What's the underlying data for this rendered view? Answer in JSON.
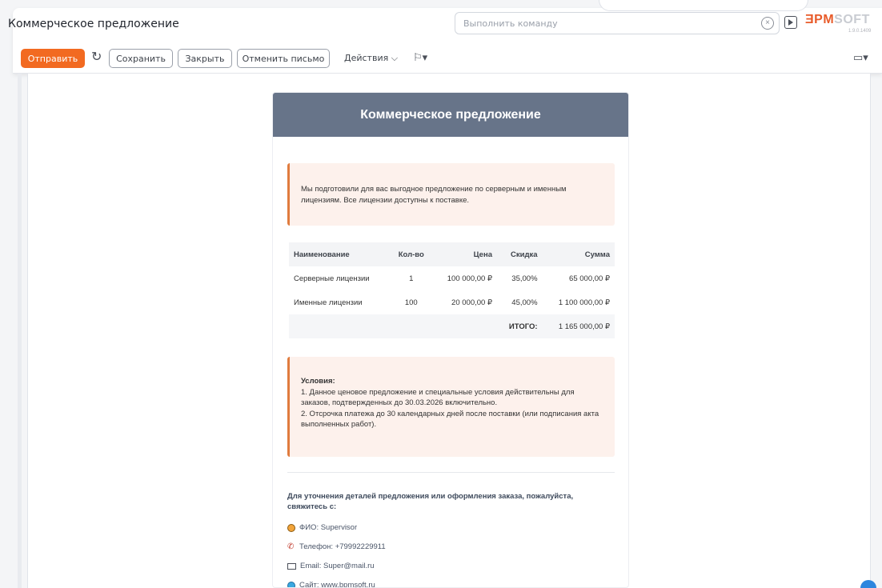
{
  "header": {
    "title": "Коммерческое предложение",
    "command_placeholder": "Выполнить команду",
    "logo_part_a": "ƎPM",
    "logo_part_b": "SOFT",
    "logo_version": "1.9.0.1409"
  },
  "toolbar": {
    "send_label": "Отправить",
    "save_label": "Сохранить",
    "close_label": "Закрыть",
    "cancel_email_label": "Отменить письмо",
    "actions_label": "Действия"
  },
  "email": {
    "heading": "Коммерческое предложение",
    "intro": "Мы подготовили для вас выгодное предложение по серверным и именным лицензиям. Все лицензии доступны к поставке.",
    "table": {
      "headers": [
        "Наименование",
        "Кол-во",
        "Цена",
        "Скидка",
        "Сумма"
      ],
      "rows": [
        [
          "Серверные лицензии",
          "1",
          "100 000,00 ₽",
          "35,00%",
          "65 000,00 ₽"
        ],
        [
          "Именные лицензии",
          "100",
          "20 000,00 ₽",
          "45,00%",
          "1 100 000,00 ₽"
        ]
      ],
      "total_label": "ИТОГО:",
      "total_value": "1 165 000,00 ₽"
    },
    "terms": {
      "title": "Условия:",
      "line1": "1. Данное ценовое предложение и специальные условия действительны для заказов, подтвержденных до 30.03.2026 включительно.",
      "line2": "2. Отсрочка платежа до 30 календарных дней после поставки (или подписания акта выполненных работ)."
    },
    "contact": {
      "title": "Для уточнения деталей предложения или оформления заказа, пожалуйста, свяжитесь с:",
      "name": "ФИО: Supervisor",
      "phone": "Телефон: +79992229911",
      "email": "Email: Super@mail.ru",
      "site": "Сайт: www.bpmsoft.ru"
    }
  }
}
